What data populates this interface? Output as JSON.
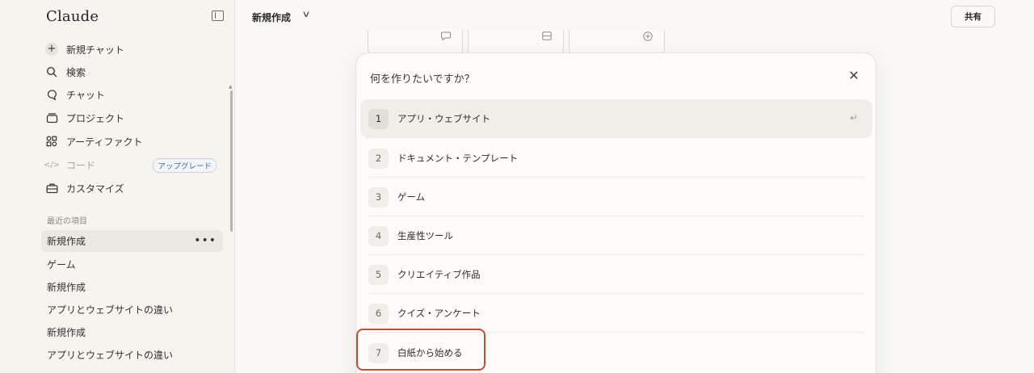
{
  "app": {
    "brand": "Claude"
  },
  "sidebar": {
    "nav": [
      {
        "label": "新規チャット",
        "icon": "plus-icon"
      },
      {
        "label": "検索",
        "icon": "search-icon"
      },
      {
        "label": "チャット",
        "icon": "chat-icon"
      },
      {
        "label": "プロジェクト",
        "icon": "folder-icon"
      },
      {
        "label": "アーティファクト",
        "icon": "artifacts-icon"
      },
      {
        "label": "コード",
        "icon": "code-icon",
        "badge": "アップグレード"
      },
      {
        "label": "カスタマイズ",
        "icon": "briefcase-icon"
      }
    ],
    "recent_header": "最近の項目",
    "recent": [
      {
        "label": "新規作成"
      },
      {
        "label": "ゲーム"
      },
      {
        "label": "新規作成"
      },
      {
        "label": "アプリとウェブサイトの違い"
      },
      {
        "label": "新規作成"
      },
      {
        "label": "アプリとウェブサイトの違い"
      }
    ]
  },
  "header": {
    "chat_title": "新規作成",
    "share_label": "共有"
  },
  "dialog": {
    "title": "何を作りたいですか？",
    "options": [
      {
        "num": "1",
        "label": "アプリ・ウェブサイト"
      },
      {
        "num": "2",
        "label": "ドキュメント・テンプレート"
      },
      {
        "num": "3",
        "label": "ゲーム"
      },
      {
        "num": "4",
        "label": "生産性ツール"
      },
      {
        "num": "5",
        "label": "クリエイティブ作品"
      },
      {
        "num": "6",
        "label": "クイズ・アンケート"
      },
      {
        "num": "7",
        "label": "白紙から始める"
      }
    ],
    "selected_index": 0,
    "highlighted_index": 6
  },
  "colors": {
    "highlight": "#c8483a",
    "badge": "#3a6fa8"
  }
}
